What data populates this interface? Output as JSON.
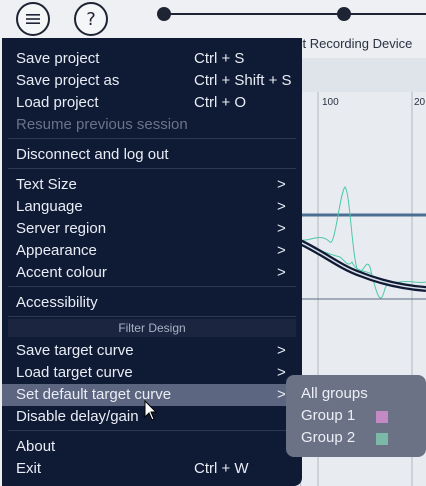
{
  "toolbar": {
    "menu_icon": "hamburger-icon",
    "help_label": "?"
  },
  "stepper": {
    "step_label": "ct Recording Device"
  },
  "chart": {
    "tick_100": "100",
    "tick_200": "20"
  },
  "menu": {
    "save_project": {
      "label": "Save project",
      "shortcut": "Ctrl + S"
    },
    "save_project_as": {
      "label": "Save project as",
      "shortcut": "Ctrl + Shift + S"
    },
    "load_project": {
      "label": "Load project",
      "shortcut": "Ctrl + O"
    },
    "resume_session": {
      "label": "Resume previous session"
    },
    "disconnect": {
      "label": "Disconnect and log out"
    },
    "text_size": {
      "label": "Text Size",
      "arrow": ">"
    },
    "language": {
      "label": "Language",
      "arrow": ">"
    },
    "server_region": {
      "label": "Server region",
      "arrow": ">"
    },
    "appearance": {
      "label": "Appearance",
      "arrow": ">"
    },
    "accent_colour": {
      "label": "Accent colour",
      "arrow": ">"
    },
    "accessibility": {
      "label": "Accessibility"
    },
    "filter_design_header": "Filter Design",
    "save_target_curve": {
      "label": "Save target curve",
      "arrow": ">"
    },
    "load_target_curve": {
      "label": "Load target curve",
      "arrow": ">"
    },
    "set_default_target_curve": {
      "label": "Set default target curve",
      "arrow": ">"
    },
    "disable_delay_gain": {
      "label": "Disable delay/gain"
    },
    "about": {
      "label": "About"
    },
    "exit": {
      "label": "Exit",
      "shortcut": "Ctrl + W"
    }
  },
  "submenu": {
    "all_groups": "All groups",
    "group1": {
      "label": "Group 1",
      "color": "#c48ac4"
    },
    "group2": {
      "label": "Group 2",
      "color": "#7cb8a8"
    }
  },
  "colors": {
    "menu_bg": "#0f1a35",
    "highlight": "#5d6680",
    "curve_teal": "#4ec8a8"
  }
}
